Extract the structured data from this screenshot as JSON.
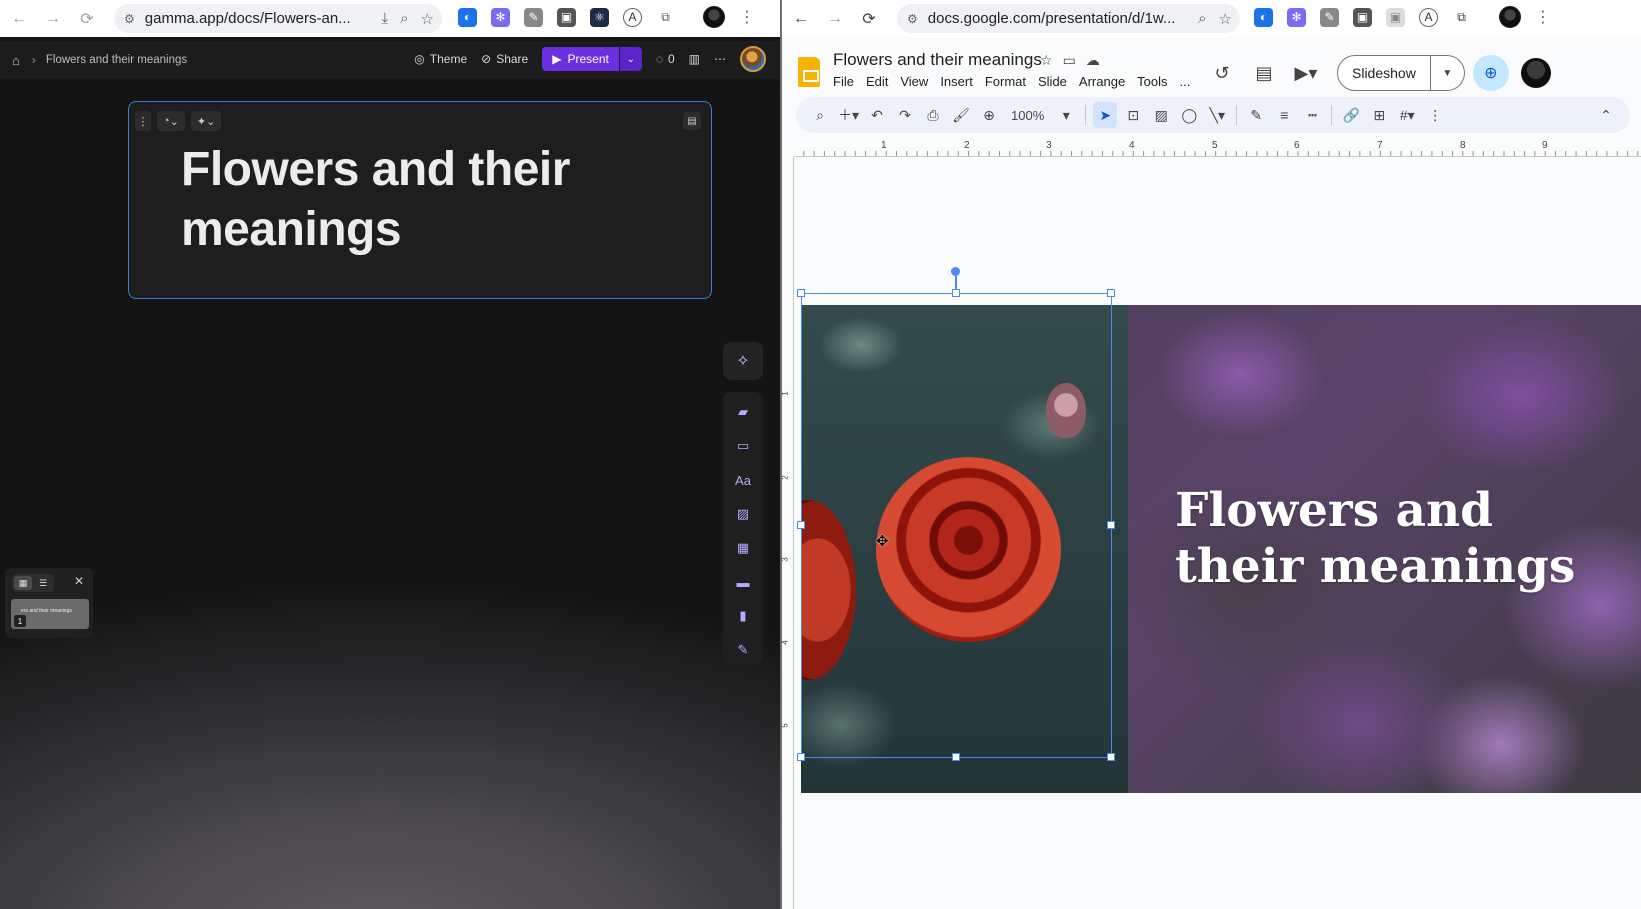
{
  "left_browser": {
    "url": "gamma.app/docs/Flowers-an...",
    "breadcrumb": "Flowers and their meanings",
    "theme_label": "Theme",
    "share_label": "Share",
    "present_label": "Present",
    "comments_count": "0",
    "card_title": "Flowers and their meanings",
    "thumbnail": {
      "number": "1",
      "text": "ers and their meanings"
    },
    "rail_icons": [
      "sparkle-ai-icon",
      "card-icon",
      "layout-icon",
      "text-icon",
      "image-icon",
      "table-icon",
      "banner-icon",
      "chart-icon",
      "edit-icon"
    ]
  },
  "right_browser": {
    "url": "docs.google.com/presentation/d/1w...",
    "doc_title": "Flowers and their meanings",
    "menu": [
      "File",
      "Edit",
      "View",
      "Insert",
      "Format",
      "Slide",
      "Arrange",
      "Tools",
      "..."
    ],
    "slideshow_label": "Slideshow",
    "zoom": "100%",
    "ruler_h": [
      "1",
      "2",
      "3",
      "4",
      "5",
      "6",
      "7",
      "8",
      "9"
    ],
    "ruler_v": [
      "1",
      "2",
      "3",
      "4",
      "5"
    ],
    "slide_title": "Flowers and their meanings"
  },
  "colors": {
    "gamma_accent": "#6b2ee0",
    "selection_blue": "#4a8af4",
    "slides_yellow": "#f4b400"
  }
}
